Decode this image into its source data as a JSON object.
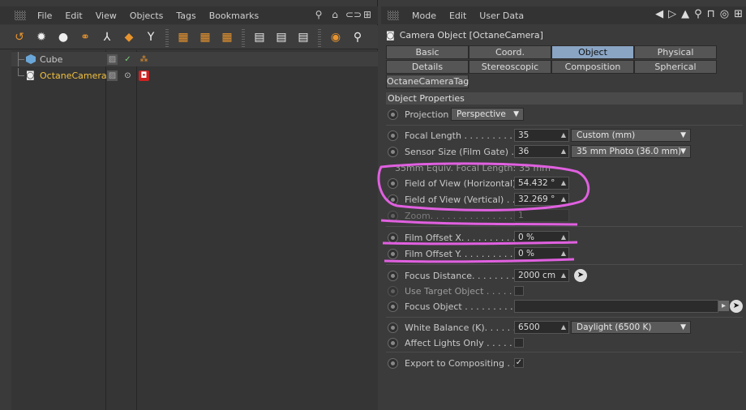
{
  "left_menu": {
    "items": [
      "File",
      "Edit",
      "View",
      "Objects",
      "Tags",
      "Bookmarks"
    ]
  },
  "objects": [
    {
      "name": "Cube",
      "color": "#c8c8c8"
    },
    {
      "name": "OctaneCamera",
      "color": "#f0c040"
    }
  ],
  "right_menu": {
    "items": [
      "Mode",
      "Edit",
      "User Data"
    ]
  },
  "header": {
    "title": "Camera Object [OctaneCamera]"
  },
  "tabs": {
    "row1": [
      "Basic",
      "Coord.",
      "Object",
      "Physical"
    ],
    "row2": [
      "Details",
      "Stereoscopic",
      "Composition",
      "Spherical"
    ],
    "row3": [
      "OctaneCameraTag"
    ],
    "active": "Object"
  },
  "section": {
    "title": "Object Properties"
  },
  "props": {
    "projection": {
      "label": "Projection",
      "value": "Perspective"
    },
    "focal_length": {
      "label": "Focal Length . . . . . . . . . . .",
      "value": "35",
      "dropdown": "Custom (mm)"
    },
    "sensor_size": {
      "label": "Sensor Size (Film Gate) . .",
      "value": "36",
      "dropdown": "35 mm Photo (36.0 mm)"
    },
    "equiv": {
      "label": "35mm Equiv. Focal Length:",
      "value": "35 mm"
    },
    "fov_h": {
      "label": "Field of View (Horizontal)",
      "value": "54.432 °"
    },
    "fov_v": {
      "label": "Field of View (Vertical) . .",
      "value": "32.269 °"
    },
    "zoom": {
      "label": "Zoom. . . . . . . . . . . . . . . . . .",
      "value": "1"
    },
    "film_x": {
      "label": "Film Offset X. . . . . . . . . . .",
      "value": "0 %"
    },
    "film_y": {
      "label": "Film Offset Y. . . . . . . . . . .",
      "value": "0 %"
    },
    "focus_distance": {
      "label": "Focus Distance. . . . . . . . .",
      "value": "2000 cm"
    },
    "use_target": {
      "label": "Use Target Object . . . . . ."
    },
    "focus_object": {
      "label": "Focus Object . . . . . . . . . ."
    },
    "white_balance": {
      "label": "White Balance (K). . . . . . .",
      "value": "6500",
      "dropdown": "Daylight (6500 K)"
    },
    "affect_lights": {
      "label": "Affect Lights Only . . . . . ."
    },
    "export_comp": {
      "label": "Export to Compositing . . ."
    }
  },
  "colors": {
    "accent_tab": "#8aa5c4",
    "annotation": "#e060e0",
    "camera_name": "#f0c040"
  }
}
